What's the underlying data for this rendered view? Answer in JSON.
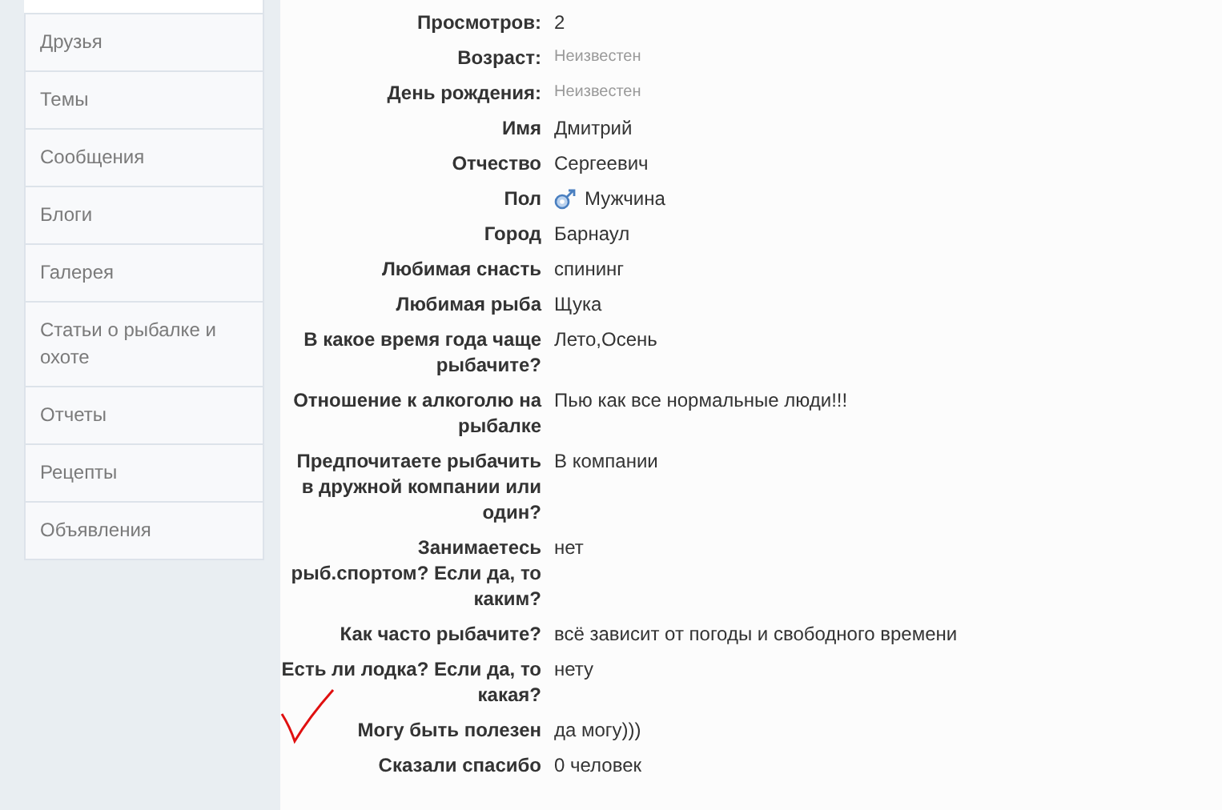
{
  "sidebar": {
    "items": [
      {
        "label": "Друзья"
      },
      {
        "label": "Темы"
      },
      {
        "label": "Сообщения"
      },
      {
        "label": "Блоги"
      },
      {
        "label": "Галерея"
      },
      {
        "label": "Статьи о рыбалке и охоте"
      },
      {
        "label": "Отчеты"
      },
      {
        "label": "Рецепты"
      },
      {
        "label": "Объявления"
      }
    ]
  },
  "profile": {
    "rows": [
      {
        "label": "Просмотров:",
        "value": "2",
        "kind": "text"
      },
      {
        "label": "Возраст:",
        "value": "Неизвестен",
        "kind": "unknown"
      },
      {
        "label": "День рождения:",
        "value": "Неизвестен",
        "kind": "unknown"
      },
      {
        "label": "Имя",
        "value": "Дмитрий",
        "kind": "text"
      },
      {
        "label": "Отчество",
        "value": "Сергеевич",
        "kind": "text"
      },
      {
        "label": "Пол",
        "value": "Мужчина",
        "kind": "gender"
      },
      {
        "label": "Город",
        "value": "Барнаул",
        "kind": "text"
      },
      {
        "label": "Любимая снасть",
        "value": "спининг",
        "kind": "text"
      },
      {
        "label": "Любимая рыба",
        "value": "Щука",
        "kind": "text"
      },
      {
        "label": "В какое время года чаще рыбачите?",
        "value": "Лето,Осень",
        "kind": "text"
      },
      {
        "label": "Отношение к алкоголю на рыбалке",
        "value": "Пью как все нормальные люди!!!",
        "kind": "text"
      },
      {
        "label": "Предпочитаете рыбачить в дружной компании или один?",
        "value": "В компании",
        "kind": "text"
      },
      {
        "label": "Занимаетесь рыб.спортом? Если да, то каким?",
        "value": "нет",
        "kind": "text"
      },
      {
        "label": "Как часто рыбачите?",
        "value": "всё зависит от погоды и свободного времени",
        "kind": "text"
      },
      {
        "label": "Есть ли лодка? Если да, то какая?",
        "value": "нету",
        "kind": "text"
      },
      {
        "label": "Могу быть полезен",
        "value": "да могу)))",
        "kind": "text"
      },
      {
        "label": "Сказали спасибо",
        "value": "0 человек",
        "kind": "text"
      }
    ]
  }
}
